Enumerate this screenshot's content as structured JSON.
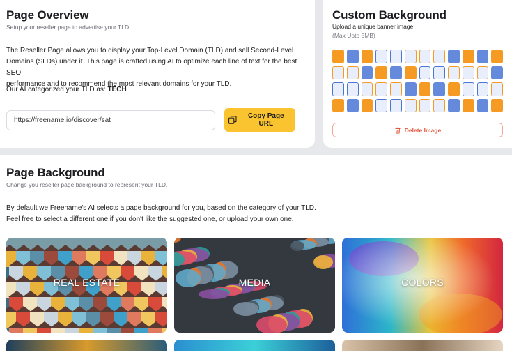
{
  "overview": {
    "title": "Page Overview",
    "subtitle": "Setup your reseller page to advertise your TLD",
    "description_line1": "The Reseller Page allows you to display your Top-Level Domain (TLD) and sell Second-Level",
    "description_line2": "Domains (SLDs) under it. This page is crafted using AI to optimize each line of text for the best SEO",
    "description_line3": "performance and to recommend the most relevant domains for your TLD.",
    "category_prefix": "Our AI categorized your TLD as:",
    "category_value": "TECH",
    "url_value": "https://freename.io/discover/sat",
    "copy_label": "Copy Page URL"
  },
  "custom_background": {
    "title": "Custom Background",
    "subtitle": "Upload a unique banner image",
    "max_size": "(Max Upto 5MB)",
    "delete_label": "Delete Image",
    "pattern_colors": [
      "#f59a23",
      "#4a76d6",
      "#e8eefb"
    ]
  },
  "page_background": {
    "title": "Page Background",
    "subtitle": "Change you reseller page background to represent your TLD.",
    "description_line1": "By default we Freename's AI selects a page background for you, based on the category of your TLD.",
    "description_line2": "Feel free to select a different one if you don't like the suggested one, or upload your own one.",
    "tiles": [
      {
        "label": "REAL ESTATE"
      },
      {
        "label": "MEDIA"
      },
      {
        "label": "COLORS"
      }
    ]
  },
  "colors": {
    "accent": "#f9c42f",
    "danger": "#e2553a"
  }
}
